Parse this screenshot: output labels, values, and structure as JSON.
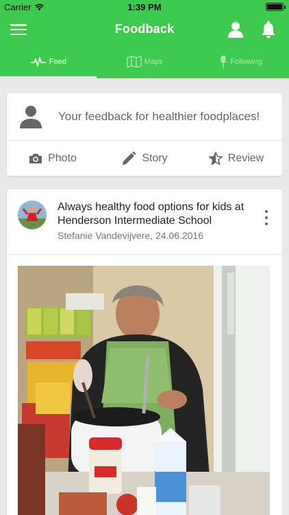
{
  "status_bar": {
    "carrier": "Carrier",
    "time": "1:39 PM"
  },
  "header": {
    "title": "Foodback"
  },
  "tabs": [
    {
      "label": "Feed",
      "icon": "heartbeat-icon",
      "active": true
    },
    {
      "label": "Maps",
      "icon": "map-icon",
      "active": false
    },
    {
      "label": "Following",
      "icon": "pin-icon",
      "active": false
    }
  ],
  "composer": {
    "prompt": "Your feedback for healthier foodplaces!",
    "actions": [
      {
        "label": "Photo",
        "icon": "camera-icon"
      },
      {
        "label": "Story",
        "icon": "pencil-icon"
      },
      {
        "label": "Review",
        "icon": "star-icon"
      }
    ]
  },
  "post": {
    "title": "Always healthy food options for kids at Henderson Intermediate School",
    "author_date": "Stefanie Vandevijvere, 24.06.2016"
  },
  "colors": {
    "brand_green": "#3ec94f",
    "background": "#e9e9e9",
    "card": "#ffffff",
    "muted_text": "#666666"
  }
}
